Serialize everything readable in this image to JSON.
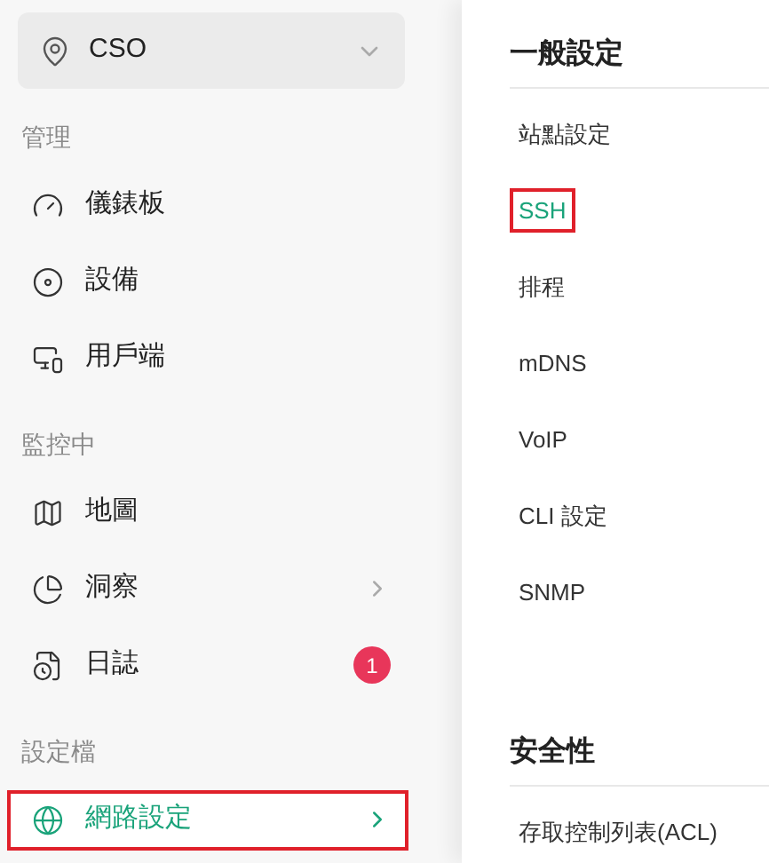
{
  "site_selector": {
    "value": "CSO"
  },
  "sidebar": {
    "sections": [
      {
        "title": "管理",
        "items": [
          {
            "label": "儀錶板",
            "selected": false,
            "has_submenu": false,
            "highlighted": false
          },
          {
            "label": "設備",
            "selected": false,
            "has_submenu": false,
            "highlighted": false
          },
          {
            "label": "用戶端",
            "selected": false,
            "has_submenu": false,
            "highlighted": false
          }
        ]
      },
      {
        "title": "監控中",
        "items": [
          {
            "label": "地圖",
            "selected": false,
            "has_submenu": false,
            "highlighted": false
          },
          {
            "label": "洞察",
            "selected": false,
            "has_submenu": true,
            "highlighted": false
          },
          {
            "label": "日誌",
            "selected": false,
            "has_submenu": false,
            "highlighted": false,
            "badge": "1"
          }
        ]
      },
      {
        "title": "設定檔",
        "items": [
          {
            "label": "網路設定",
            "selected": true,
            "has_submenu": true,
            "highlighted": true
          }
        ]
      }
    ]
  },
  "settings_menu": {
    "groups": [
      {
        "title": "一般設定",
        "items": [
          {
            "label": "站點設定",
            "selected": false,
            "highlighted": false
          },
          {
            "label": "SSH",
            "selected": true,
            "highlighted": true
          },
          {
            "label": "排程",
            "selected": false,
            "highlighted": false
          },
          {
            "label": "mDNS",
            "selected": false,
            "highlighted": false
          },
          {
            "label": "VoIP",
            "selected": false,
            "highlighted": false
          },
          {
            "label": "CLI 設定",
            "selected": false,
            "highlighted": false
          },
          {
            "label": "SNMP",
            "selected": false,
            "highlighted": false
          }
        ]
      },
      {
        "title": "安全性",
        "items": [
          {
            "label": "存取控制列表(ACL)",
            "selected": false,
            "highlighted": false
          }
        ]
      }
    ]
  }
}
